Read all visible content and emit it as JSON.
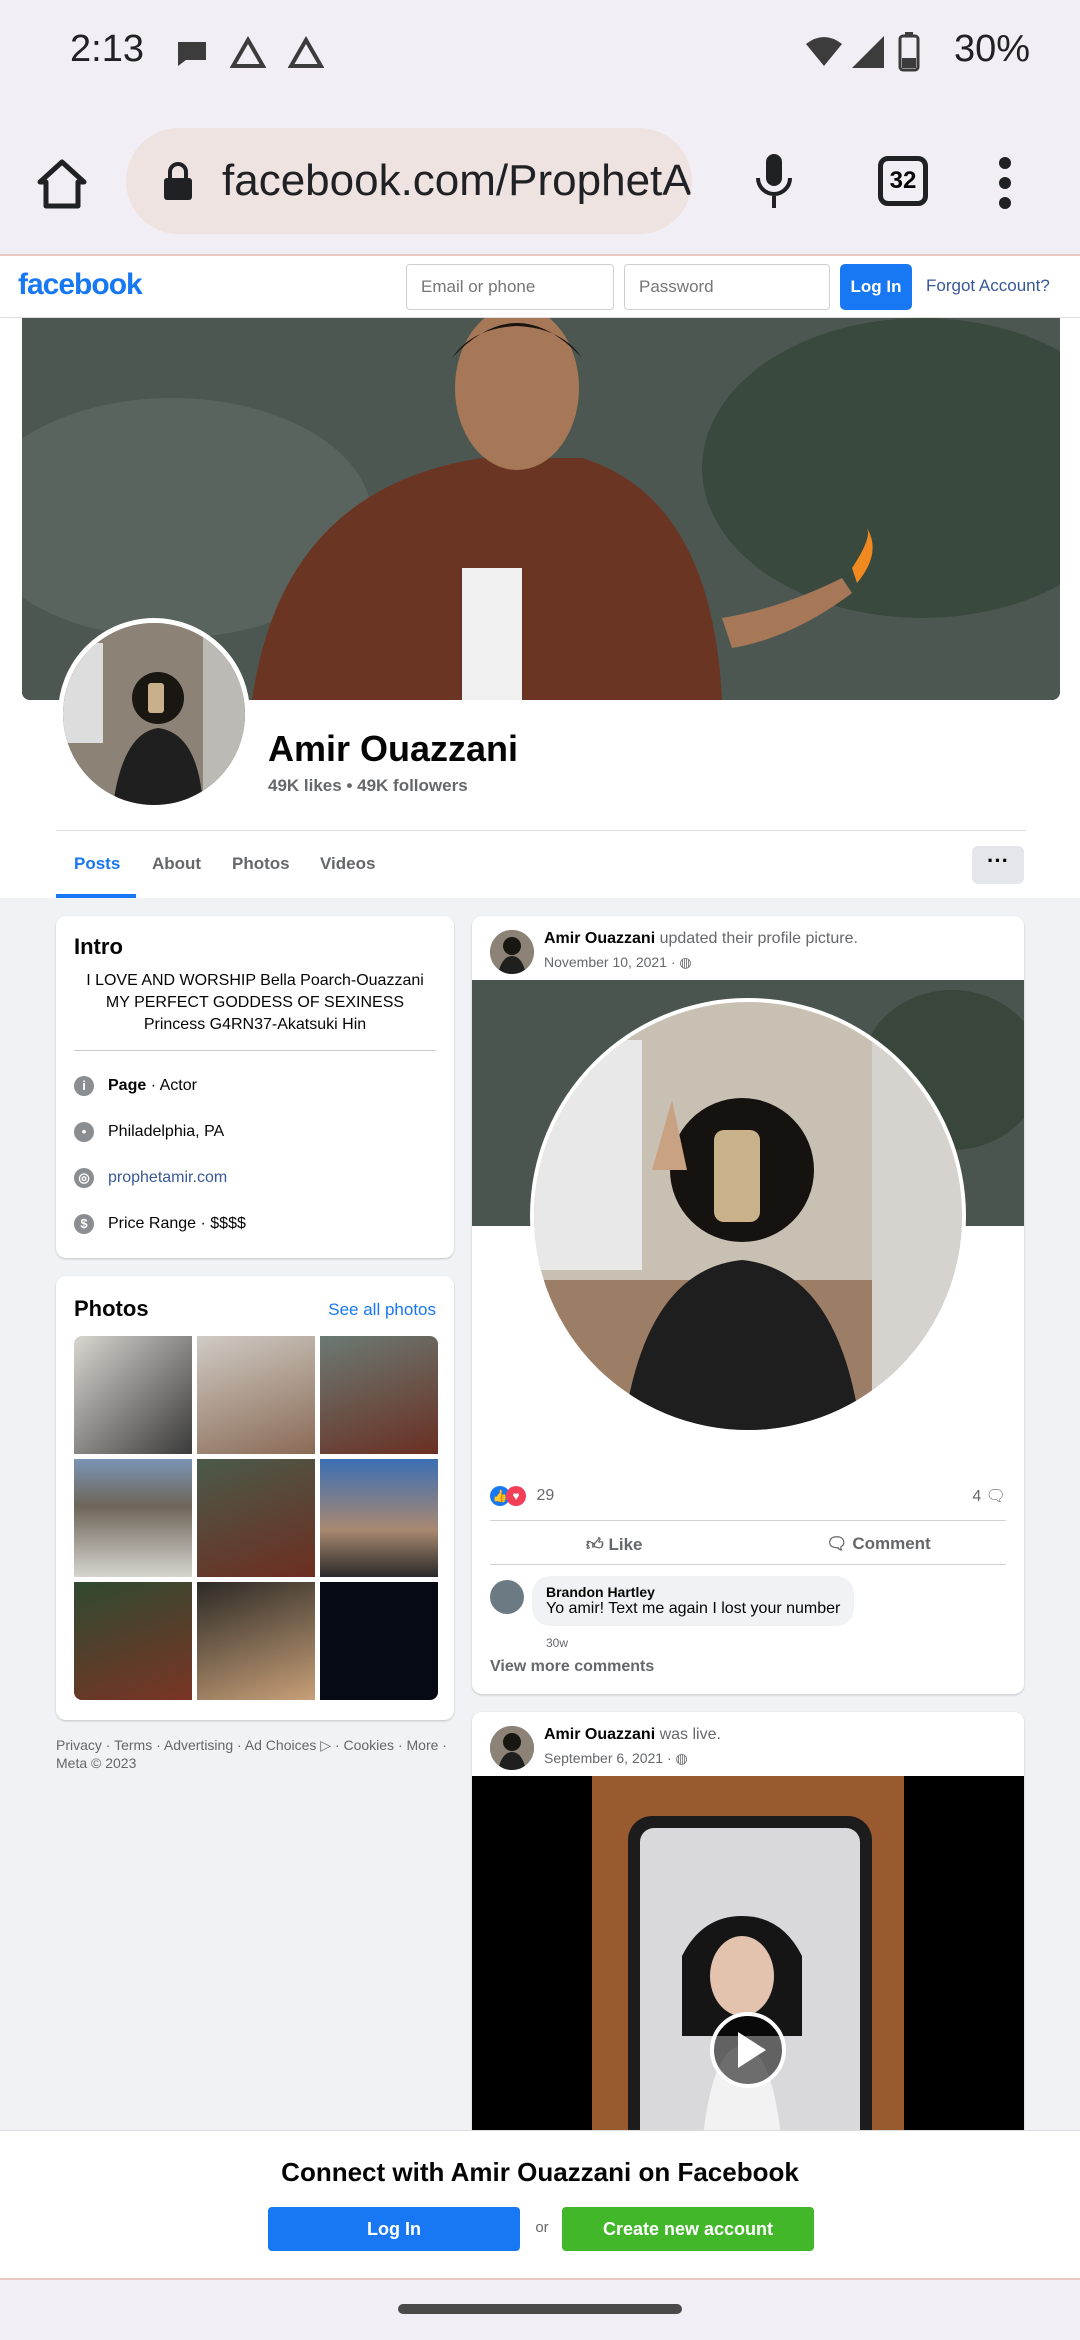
{
  "status_bar": {
    "time": "2:13",
    "battery": "30%"
  },
  "browser": {
    "url": "facebook.com/ProphetA",
    "tab_count": "32"
  },
  "fb_header": {
    "logo": "facebook",
    "email_placeholder": "Email or phone",
    "password_placeholder": "Password",
    "login_label": "Log In",
    "forgot_label": "Forgot Account?"
  },
  "profile": {
    "name": "Amir Ouazzani",
    "stats": "49K likes • 49K followers"
  },
  "tabs": [
    "Posts",
    "About",
    "Photos",
    "Videos"
  ],
  "tabs_more": "···",
  "intro": {
    "title": "Intro",
    "bio": "I LOVE AND WORSHIP Bella Poarch-Ouazzani MY PERFECT GODDESS OF SEXINESS Princess G4RN37-Akatsuki Hin",
    "page_label": "Page",
    "page_category": " · Actor",
    "location": "Philadelphia, PA",
    "website": "prophetamir.com",
    "price_range": "Price Range · $$$$"
  },
  "photos": {
    "title": "Photos",
    "see_all": "See all photos"
  },
  "footer": {
    "links": "Privacy · Terms · Advertising · Ad Choices ▷ · Cookies · More ·",
    "copyright": "Meta © 2023"
  },
  "post1": {
    "author": "Amir Ouazzani",
    "action": " updated their profile picture.",
    "date": "November 10, 2021 · ",
    "reaction_count": "29",
    "comment_count": "4",
    "like_label": "Like",
    "comment_label": "Comment",
    "comment_author": "Brandon Hartley",
    "comment_text": "Yo amir! Text me again I lost your number",
    "comment_time": "30w",
    "view_more": "View more comments"
  },
  "post2": {
    "author": "Amir Ouazzani",
    "action": " was live.",
    "date": "September 6, 2021 · "
  },
  "banner": {
    "title": "Connect with Amir Ouazzani on Facebook",
    "login": "Log In",
    "or": "or",
    "create": "Create new account"
  },
  "colors": {
    "brand": "#1877f2",
    "create_green": "#42b72a"
  }
}
